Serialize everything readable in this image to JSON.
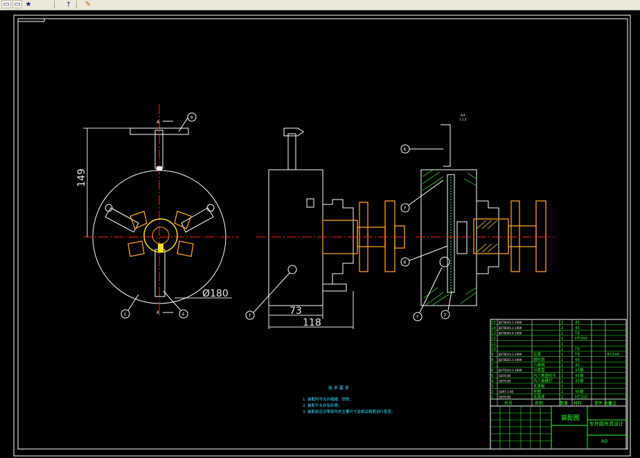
{
  "toolbar": {
    "buttons": [
      {
        "icon": "new-document-icon",
        "glyph": "▭"
      },
      {
        "icon": "open-folder-icon",
        "glyph": "▭"
      },
      {
        "icon": "star-icon",
        "glyph": "★"
      },
      {
        "icon": "pin-icon",
        "glyph": "†"
      },
      {
        "icon": "paint-icon",
        "glyph": "✎"
      }
    ]
  },
  "drawing": {
    "dim_height": "149",
    "dim_diameter": "Ø180",
    "dim_73": "73",
    "dim_118": "118",
    "section_label_top": "A",
    "section_label_bottom": "A",
    "scale_note": "A-A",
    "scale_ratio": "1:1.5",
    "balloons": [
      "9",
      "1",
      "4",
      "7",
      "6",
      "7",
      "8",
      "7",
      "2"
    ]
  },
  "tech_requirements": {
    "title": "技 术 要 求",
    "lines": [
      "1. 装配时不允许磕碰、划伤；",
      "2. 装配不允许有砂眼；",
      "3. 装配前应对零部件的主要尺寸及相关精度进行复查。"
    ]
  },
  "bom": {
    "rows": [
      {
        "code": "JB/T8045.5-1999",
        "name": "",
        "qty": "2",
        "material": "45",
        "note": ""
      },
      {
        "code": "JB/T8045.3-1999",
        "name": "",
        "qty": "2",
        "material": "45",
        "note": ""
      },
      {
        "code": "JB/T8045.4-1999",
        "name": "",
        "qty": "1",
        "material": "T8",
        "note": ""
      },
      {
        "code": "",
        "name": "",
        "qty": "1",
        "material": "HT200",
        "note": ""
      },
      {
        "code": "",
        "name": "",
        "qty": "1",
        "material": "",
        "note": ""
      },
      {
        "code": "",
        "name": "",
        "qty": "1",
        "material": "T8",
        "note": ""
      },
      {
        "code": "JB/T8014.3-1999",
        "name": "钻套",
        "qty": "1",
        "material": "T8",
        "note": "Φ12x6"
      },
      {
        "code": "JB/T8021.5-1999",
        "name": "圆柱销",
        "qty": "1",
        "material": "45",
        "note": ""
      },
      {
        "code": "",
        "name": "六角销",
        "qty": "1",
        "material": "45",
        "note": ""
      },
      {
        "code": "JB/T5010.1-1999",
        "name": "分度盘",
        "qty": "1",
        "material": "35钢",
        "note": ""
      },
      {
        "code": "GB70-85",
        "name": "内六角圆柱头",
        "qty": "1",
        "material": "45钢",
        "note": ""
      },
      {
        "code": "GB70-85",
        "name": "内六角螺钉",
        "qty": "2",
        "material": "45钢",
        "note": ""
      },
      {
        "code": "",
        "name": "支承板",
        "qty": "1",
        "material": "",
        "note": ""
      },
      {
        "code": "GB97.1-85",
        "name": "垫圈",
        "qty": "1",
        "material": "45钢",
        "note": ""
      },
      {
        "code": "GB70-85",
        "name": "夹具体",
        "qty": "1",
        "material": "HT200",
        "note": ""
      }
    ],
    "header": {
      "code": "代号",
      "name": "名称",
      "qty": "数量",
      "material": "材料",
      "weight": "单件 总计",
      "note": "备注"
    }
  },
  "title_block": {
    "drawing_name": "装配图",
    "project": "车外圆夹具设计",
    "size": "A0"
  },
  "colors": {
    "background": "#000000",
    "outline": "#ffffff",
    "centerline": "#ff2020",
    "part_orange": "#ffa020",
    "part_yellow": "#ffe020",
    "hatch_green": "#40ff40",
    "text_cyan": "#40e0ff",
    "bom_green": "#30ff30",
    "dim_white": "#e8e8e8"
  }
}
